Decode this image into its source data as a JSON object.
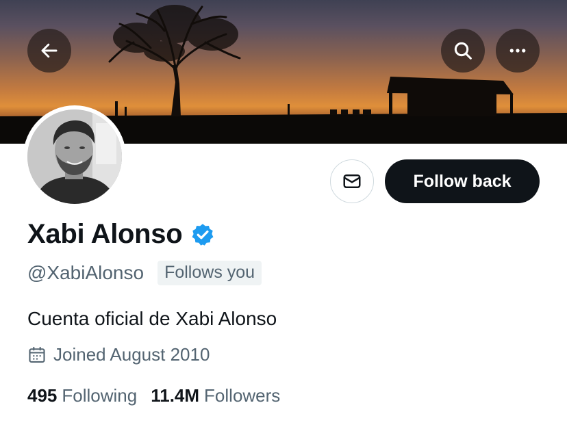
{
  "profile": {
    "display_name": "Xabi Alonso",
    "handle": "@XabiAlonso",
    "follows_you_badge": "Follows you",
    "bio": "Cuenta oficial de Xabi Alonso",
    "joined": "Joined August 2010",
    "verified": true
  },
  "actions": {
    "follow_back_label": "Follow back"
  },
  "stats": {
    "following_count": "495",
    "following_label": "Following",
    "followers_count": "11.4M",
    "followers_label": "Followers"
  },
  "icons": {
    "back": "back-arrow-icon",
    "search": "search-icon",
    "more": "more-options-icon",
    "message": "mail-icon",
    "verified": "verified-badge-icon",
    "calendar": "calendar-icon"
  },
  "colors": {
    "primary_text": "#0f1419",
    "secondary_text": "#536471",
    "verified_blue": "#1d9bf0",
    "button_dark": "#0f1419"
  }
}
